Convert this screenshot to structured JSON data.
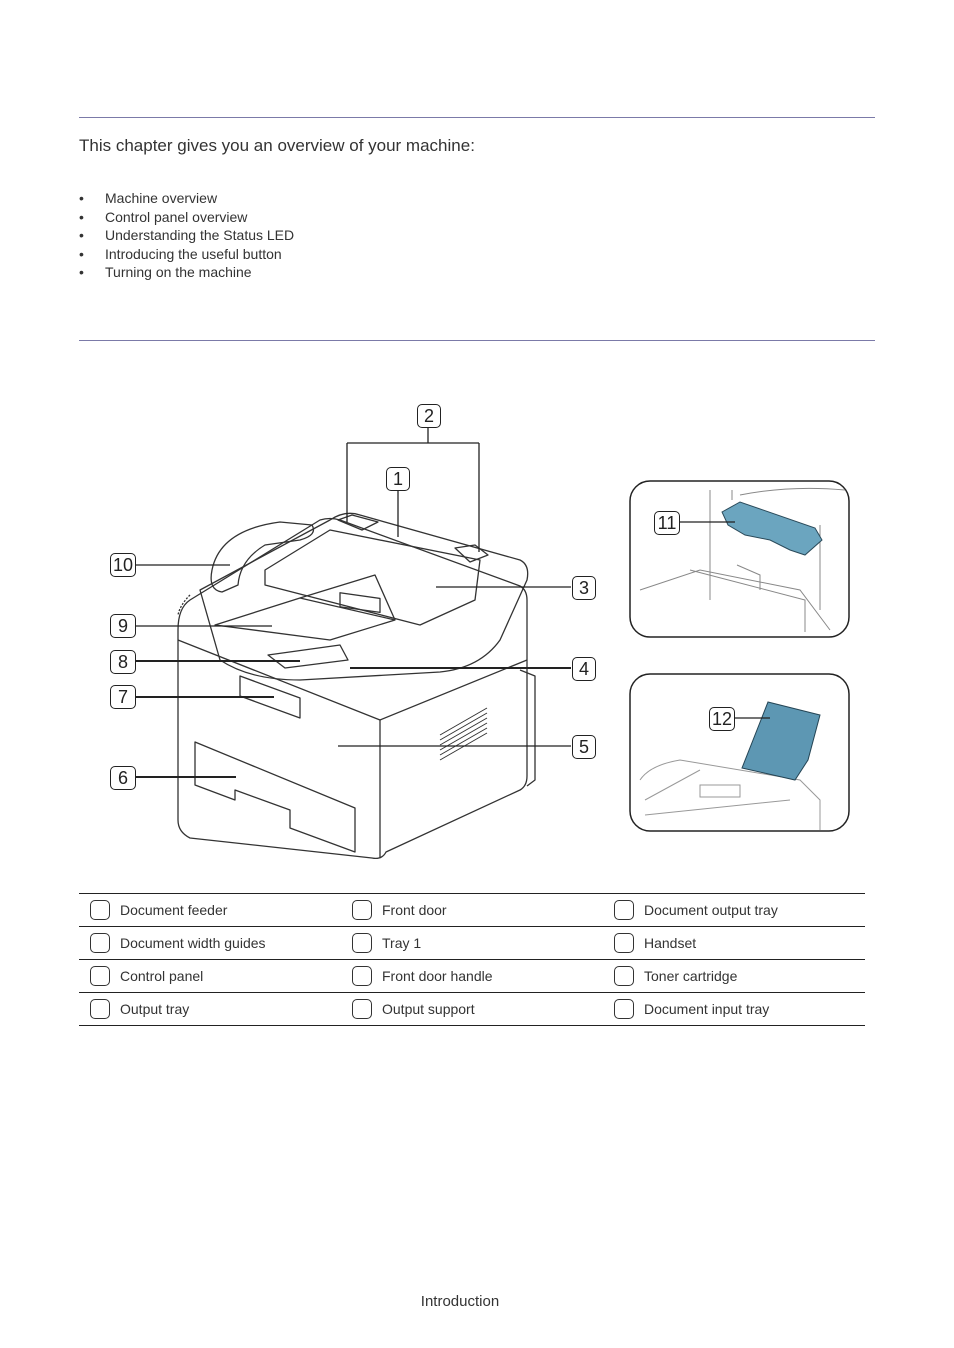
{
  "intro": "This chapter gives you an overview of your machine:",
  "toc": [
    "Machine overview",
    "Control panel overview",
    "Understanding the Status LED",
    "Introducing the useful button",
    "Turning on the machine"
  ],
  "bullet": "•",
  "colors": {
    "rule": "#7b7aa8",
    "accent_part": "#5f93ad"
  },
  "diagram": {
    "callouts": [
      "1",
      "2",
      "3",
      "4",
      "5",
      "6",
      "7",
      "8",
      "9",
      "10",
      "11",
      "12"
    ]
  },
  "parts": [
    [
      "Document feeder",
      "Front door",
      "Document output tray"
    ],
    [
      "Document width guides",
      "Tray 1",
      "Handset"
    ],
    [
      "Control panel",
      "Front door handle",
      "Toner cartridge"
    ],
    [
      "Output tray",
      "Output support",
      "Document input tray"
    ]
  ],
  "footer": "Introduction"
}
